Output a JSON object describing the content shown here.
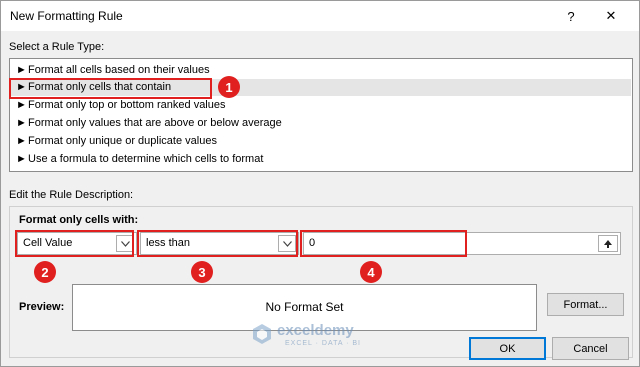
{
  "dialog": {
    "title": "New Formatting Rule",
    "help_glyph": "?",
    "close_glyph": "✕"
  },
  "rule_type": {
    "label": "Select a Rule Type:",
    "items": [
      "Format all cells based on their values",
      "Format only cells that contain",
      "Format only top or bottom ranked values",
      "Format only values that are above or below average",
      "Format only unique or duplicate values",
      "Use a formula to determine which cells to format"
    ],
    "selected_index": 1
  },
  "description": {
    "label": "Edit the Rule Description:",
    "group_label": "Format only cells with:",
    "cell_value": "Cell Value",
    "operator": "less than",
    "value": "0",
    "preview_label": "Preview:",
    "preview_text": "No Format Set",
    "format_button": "Format..."
  },
  "buttons": {
    "ok": "OK",
    "cancel": "Cancel"
  },
  "badges": [
    "1",
    "2",
    "3",
    "4"
  ],
  "watermark": {
    "brand": "exceldemy",
    "tagline": "EXCEL · DATA · BI"
  },
  "colors": {
    "annotation_red": "#e0201f",
    "accent": "#0078d7"
  }
}
